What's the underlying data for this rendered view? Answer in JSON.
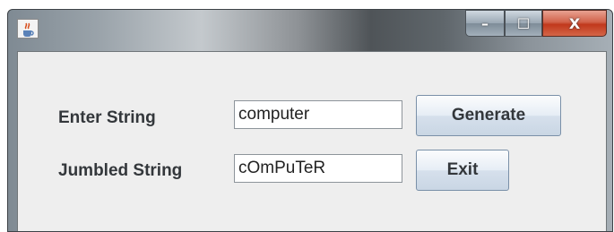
{
  "window": {
    "controls": {
      "minimize": "–",
      "maximize": "☐",
      "close": "X"
    }
  },
  "form": {
    "enter_label": "Enter String",
    "enter_value": "computer",
    "jumbled_label": "Jumbled String",
    "jumbled_value": "cOmPuTeR",
    "generate_label": "Generate",
    "exit_label": "Exit"
  }
}
